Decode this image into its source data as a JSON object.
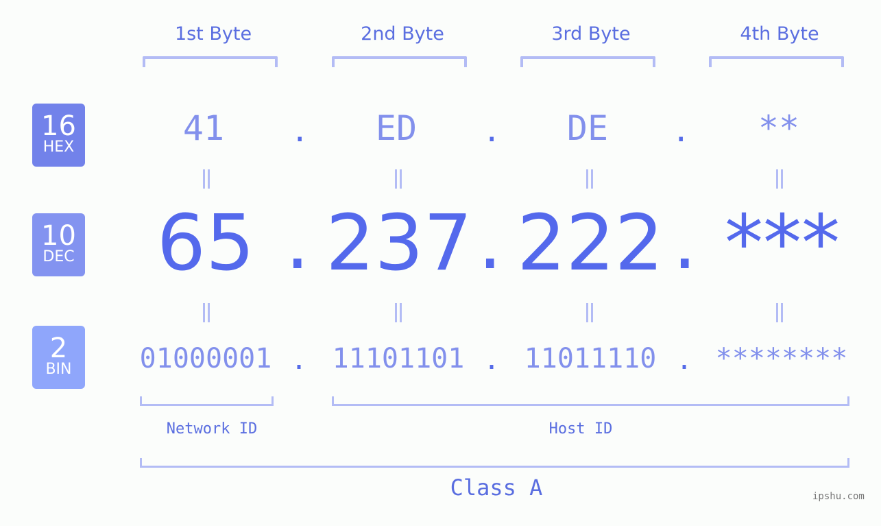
{
  "byte_headers": [
    "1st Byte",
    "2nd Byte",
    "3rd Byte",
    "4th Byte"
  ],
  "badges": [
    {
      "base": "16",
      "name": "HEX",
      "color": "#7282ea"
    },
    {
      "base": "10",
      "name": "DEC",
      "color": "#8393f0"
    },
    {
      "base": "2",
      "name": "BIN",
      "color": "#8fa6fb"
    }
  ],
  "hex": [
    "41",
    "ED",
    "DE",
    "**"
  ],
  "dec": [
    "65",
    "237",
    "222",
    "***"
  ],
  "bin": [
    "01000001",
    "11101101",
    "11011110",
    "********"
  ],
  "separator": ".",
  "network_label": "Network ID",
  "host_label": "Host ID",
  "class_label": "Class A",
  "watermark": "ipshu.com",
  "colors": {
    "accent": "#5469ec",
    "light": "#8290ec",
    "bracket": "#b3bcf5"
  }
}
